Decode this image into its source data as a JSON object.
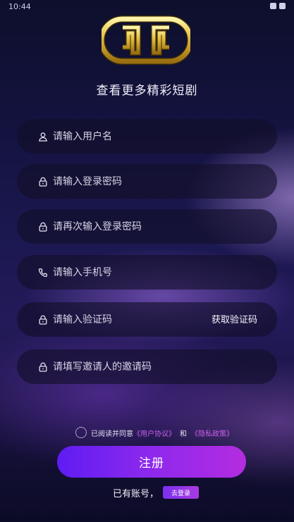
{
  "status_bar": {
    "time": "10:44"
  },
  "header": {
    "tagline": "查看更多精彩短剧"
  },
  "form": {
    "username": {
      "placeholder": "请输入用户名",
      "icon": "user-icon"
    },
    "password": {
      "placeholder": "请输入登录密码",
      "icon": "lock-icon"
    },
    "password_confirm": {
      "placeholder": "请再次输入登录密码",
      "icon": "lock-icon"
    },
    "phone": {
      "placeholder": "请输入手机号",
      "icon": "phone-icon"
    },
    "sms_code": {
      "placeholder": "请输入验证码",
      "icon": "lock-icon",
      "button_label": "获取验证码"
    },
    "invite_code": {
      "placeholder": "请填写邀请人的邀请码",
      "icon": "lock-icon"
    }
  },
  "agreement": {
    "prefix": "已阅读并同意",
    "user_agreement": "《用户协议》",
    "conjunction": "和",
    "privacy_policy": "《隐私政策》"
  },
  "register_button": "注册",
  "login_prompt": {
    "text": "已有账号，",
    "button": "去登录"
  },
  "colors": {
    "accent_gradient_start": "#5e1cf2",
    "accent_gradient_end": "#b42ce0",
    "link": "#c660e8",
    "logo_gold": "#d9b43a"
  }
}
